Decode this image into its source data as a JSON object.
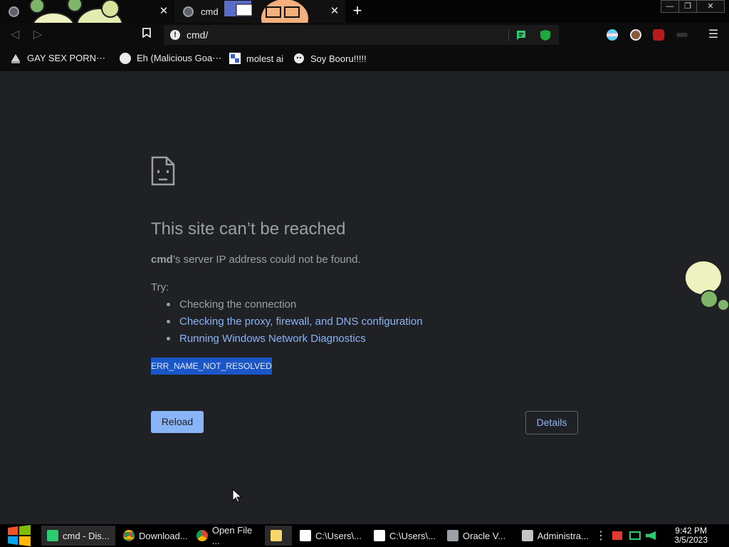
{
  "browser": {
    "tabs": [
      {
        "title": ""
      },
      {
        "title": "cmd"
      }
    ],
    "new_tab": "+",
    "window": {
      "minimize": "—",
      "restore": "❐",
      "close": "✕"
    },
    "address": "cmd/",
    "bookmarks": [
      {
        "label": "GAY SEX PORN⋯"
      },
      {
        "label": "Eh (Malicious Goa⋯"
      },
      {
        "label": "molest ai"
      },
      {
        "label": "Soy Booru!!!!!"
      }
    ]
  },
  "error_page": {
    "title": "This site can’t be reached",
    "host": "cmd",
    "description": "’s server IP address could not be found.",
    "try_label": "Try:",
    "suggestions": [
      {
        "text": "Checking the connection",
        "link": false
      },
      {
        "text": "Checking the proxy, firewall, and DNS configuration",
        "link": true
      },
      {
        "text": "Running Windows Network Diagnostics",
        "link": true
      }
    ],
    "error_code": "ERR_NAME_NOT_RESOLVED",
    "reload_label": "Reload",
    "details_label": "Details"
  },
  "taskbar": {
    "items": [
      {
        "label": "cmd - Dis...",
        "icon": "discord-icon",
        "color": "#2ecc71"
      },
      {
        "label": "Download...",
        "icon": "chrome-icon",
        "color": "#e8eaed"
      },
      {
        "label": "Open File ...",
        "icon": "chrome-icon",
        "color": "#e8eaed"
      },
      {
        "label": "",
        "icon": "folder-icon",
        "color": "#f5d76e"
      },
      {
        "label": "C:\\Users\\...",
        "icon": "7zip-icon",
        "color": "#ffffff"
      },
      {
        "label": "C:\\Users\\...",
        "icon": "7zip-icon",
        "color": "#ffffff"
      },
      {
        "label": "Oracle V...",
        "icon": "virtualbox-icon",
        "color": "#9aa0a6"
      },
      {
        "label": "Administra...",
        "icon": "terminal-icon",
        "color": "#9aa0a6"
      }
    ],
    "time": "9:42 PM",
    "date": "3/5/2023"
  },
  "colors": {
    "link": "#8ab4f8",
    "text": "#9aa0a6",
    "selection": "#1a56c7"
  }
}
